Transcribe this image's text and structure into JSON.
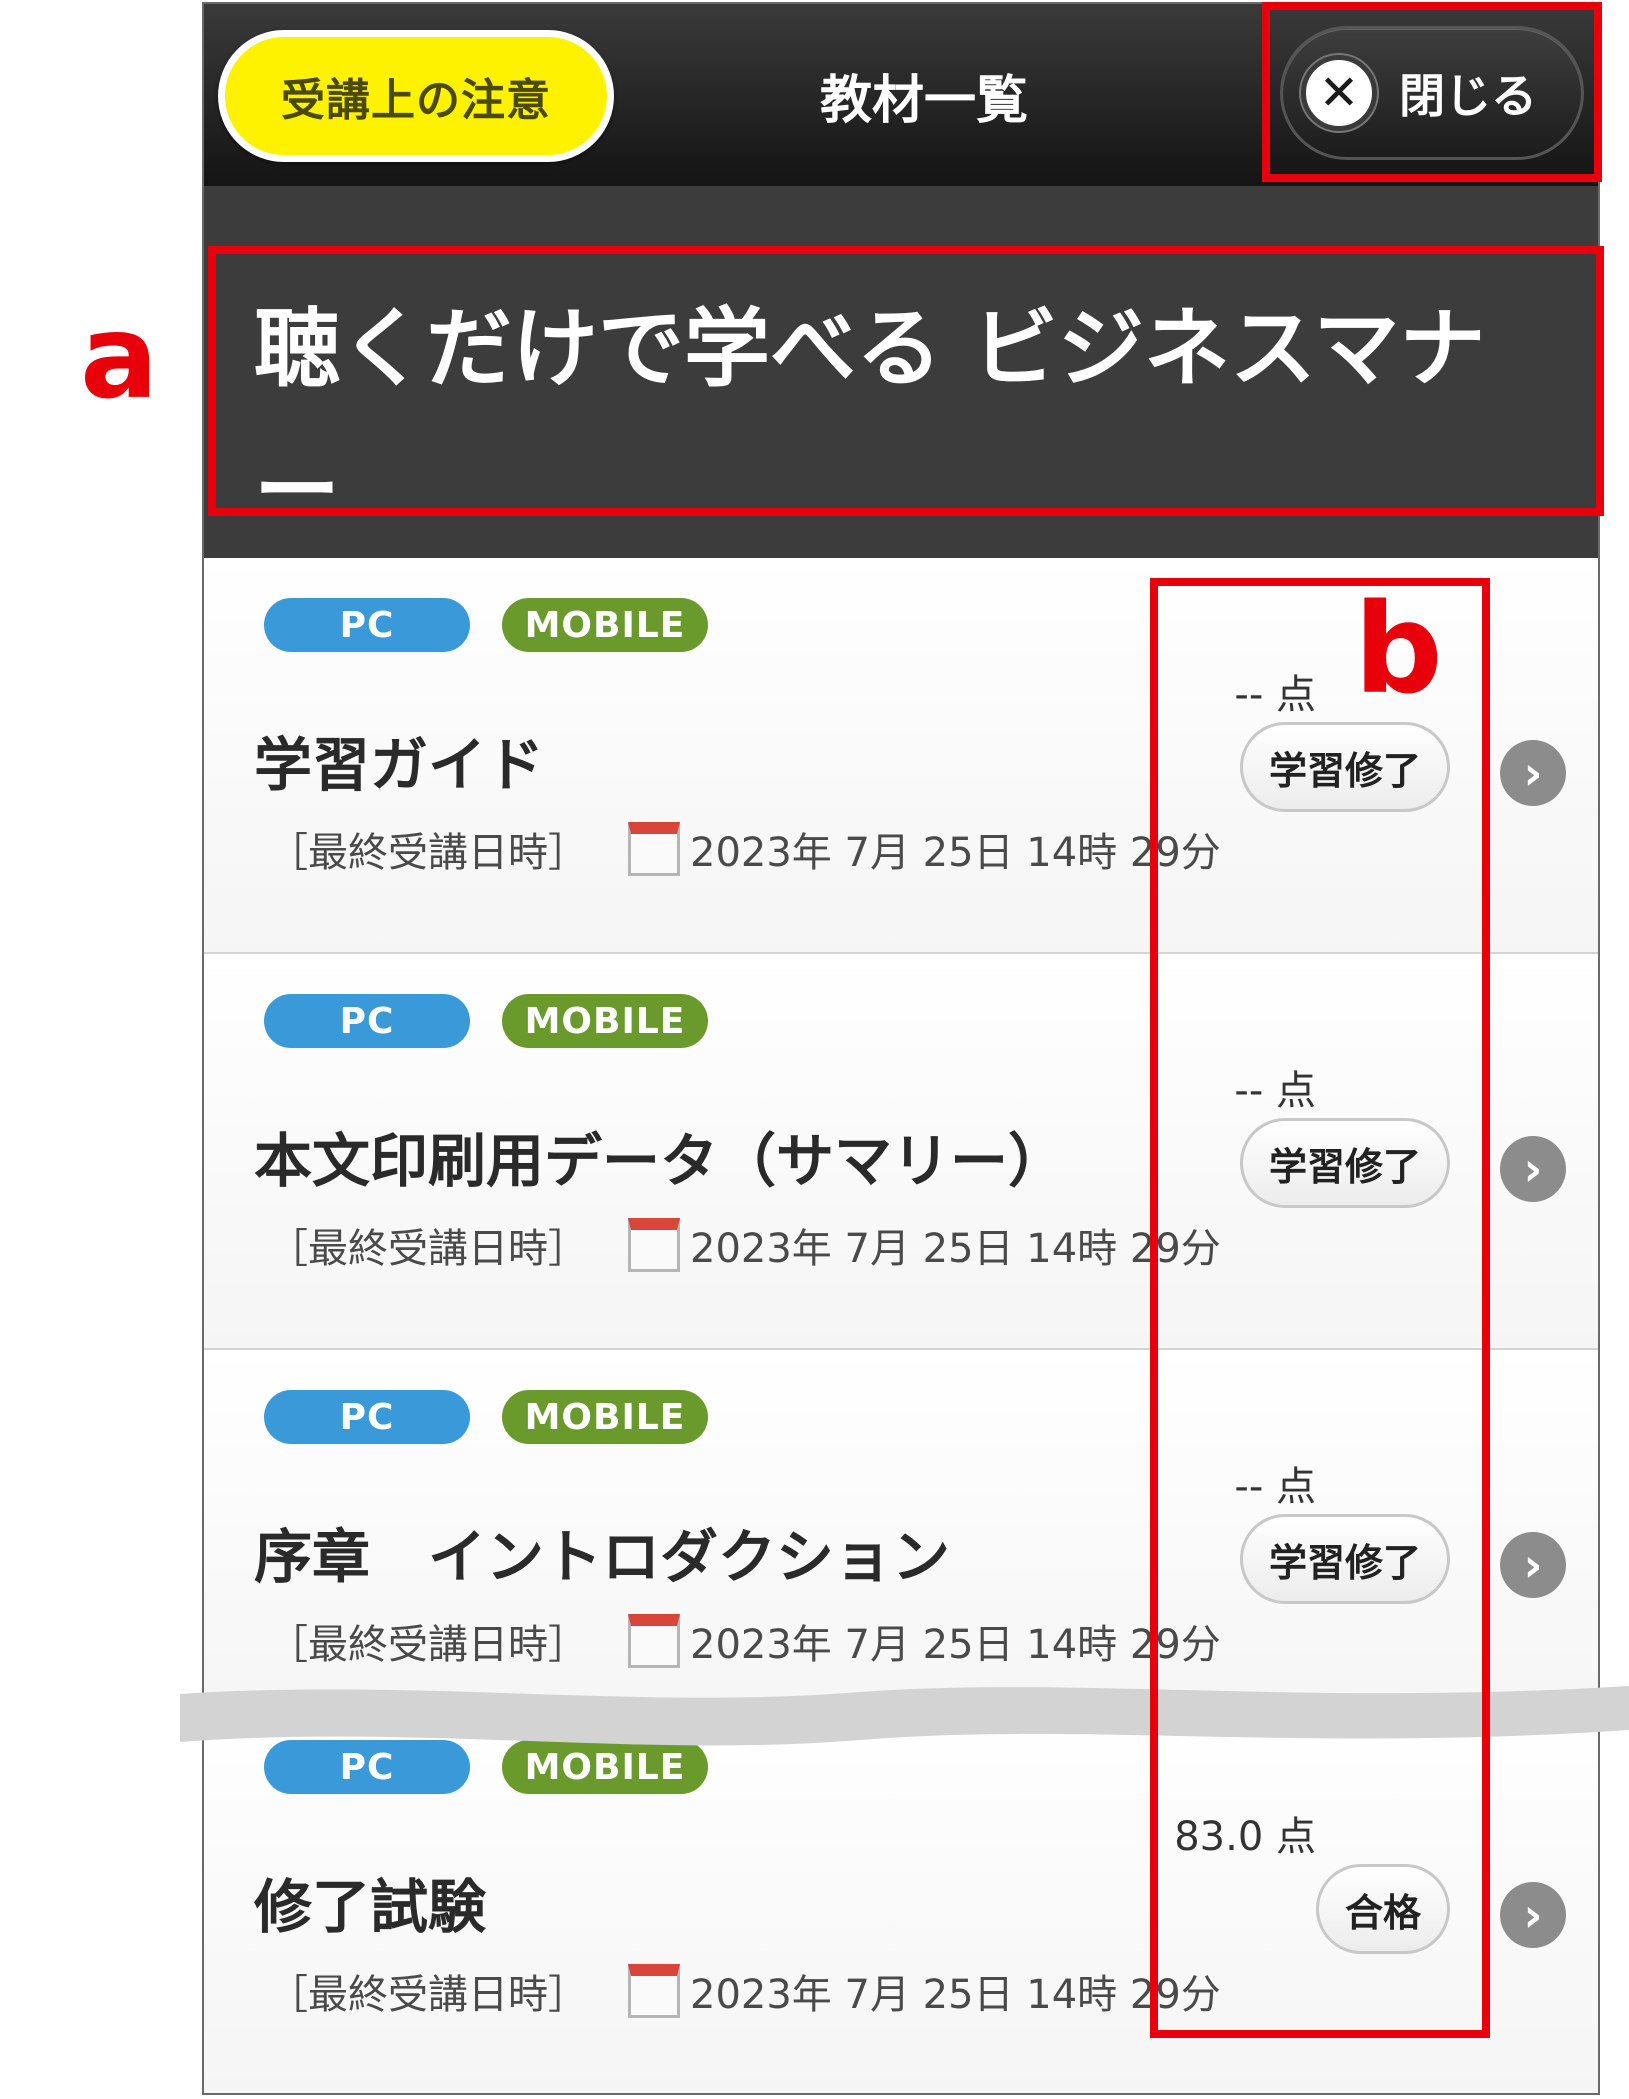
{
  "header": {
    "notice_label": "受講上の注意",
    "title": "教材一覧",
    "close_label": "閉じる"
  },
  "course": {
    "title": "聴くだけで学べる ビジネスマナー"
  },
  "items": [
    {
      "badges": [
        "PC",
        "MOBILE"
      ],
      "score": "-- 点",
      "title": "学習ガイド",
      "status": "学習修了",
      "last_access_label": "［最終受講日時］",
      "last_access": "2023年 7月 25日 14時 29分"
    },
    {
      "badges": [
        "PC",
        "MOBILE"
      ],
      "score": "-- 点",
      "title": "本文印刷用データ（サマリー）",
      "status": "学習修了",
      "last_access_label": "［最終受講日時］",
      "last_access": "2023年 7月 25日 14時 29分"
    },
    {
      "badges": [
        "PC",
        "MOBILE"
      ],
      "score": "-- 点",
      "title": "序章　イントロダクション",
      "status": "学習修了",
      "last_access_label": "［最終受講日時］",
      "last_access": "2023年 7月 25日 14時 29分"
    },
    {
      "badges": [
        "PC",
        "MOBILE"
      ],
      "score": "83.0 点",
      "title": "修了試験",
      "status": "合格",
      "last_access_label": "［最終受講日時］",
      "last_access": "2023年 7月 25日 14時 29分"
    }
  ],
  "annotations": {
    "a": "a",
    "b": "b"
  },
  "colors": {
    "annotation_red": "#e8000b",
    "notice_yellow": "#fff200",
    "pc_badge_blue": "#3a9ad9",
    "mobile_badge_green": "#6a9a2b"
  }
}
